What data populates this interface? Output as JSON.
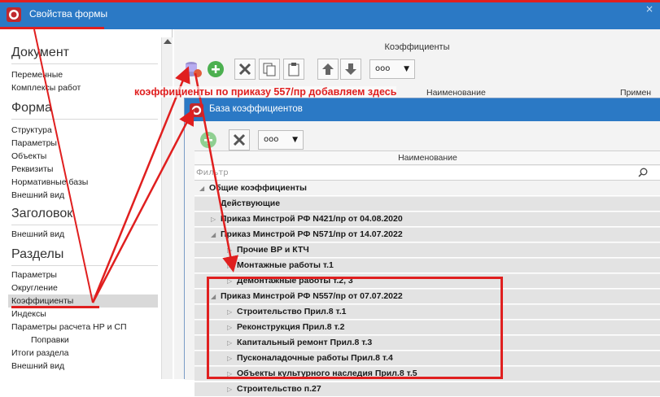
{
  "main_window": {
    "title": "Свойства формы",
    "close": "×"
  },
  "nav": {
    "sections": [
      {
        "title": "Документ",
        "items": [
          "Переменные",
          "Комплексы работ"
        ]
      },
      {
        "title": "Форма",
        "items": [
          "Структура",
          "Параметры",
          "Объекты",
          "Реквизиты",
          "Нормативные базы",
          "Внешний вид"
        ]
      },
      {
        "title": "Заголовок",
        "items": [
          "Внешний вид"
        ]
      },
      {
        "title": "Разделы",
        "items": [
          "Параметры",
          "Округление",
          "Коэффициенты",
          "Индексы",
          "Параметры расчета НР и СП",
          "Поправки",
          "Итоги раздела",
          "Внешний вид"
        ]
      }
    ],
    "selected_item": "Коэффициенты"
  },
  "background_window": {
    "header": "Коэффициенты",
    "dropdown_label": "ooo",
    "columns": [
      "Наименование",
      "Примен"
    ]
  },
  "annotation": {
    "text": "коэффициенты по приказу 557/пр добавляем здесь",
    "color": "#e01f1f"
  },
  "dialog": {
    "title": "База коэффициентов",
    "dropdown_label": "ooo",
    "column_header": "Наименование",
    "filter_placeholder": "Фильтр",
    "tree": [
      {
        "label": "Общие коэффициенты",
        "level": 0,
        "arrow": "◢",
        "grey": false
      },
      {
        "label": "Действующие",
        "level": 1,
        "arrow": "",
        "grey": true
      },
      {
        "label": "Приказ Минстрой РФ N421/пр от 04.08.2020",
        "level": 1,
        "arrow": "▷",
        "grey": true
      },
      {
        "label": "Приказ Минстрой РФ N571/пр от 14.07.2022",
        "level": 1,
        "arrow": "◢",
        "grey": true
      },
      {
        "label": "Прочие ВР и КТЧ",
        "level": 2,
        "arrow": "▷",
        "grey": true
      },
      {
        "label": "Монтажные работы т.1",
        "level": 2,
        "arrow": "▷",
        "grey": true
      },
      {
        "label": "Демонтажные работы т.2, 3",
        "level": 2,
        "arrow": "▷",
        "grey": true
      },
      {
        "label": "Приказ Минстрой РФ N557/пр от 07.07.2022",
        "level": 1,
        "arrow": "◢",
        "grey": true
      },
      {
        "label": "Строительство Прил.8 т.1",
        "level": 2,
        "arrow": "▷",
        "grey": true
      },
      {
        "label": "Реконструкция Прил.8 т.2",
        "level": 2,
        "arrow": "▷",
        "grey": true
      },
      {
        "label": "Капитальный ремонт Прил.8 т.3",
        "level": 2,
        "arrow": "▷",
        "grey": true
      },
      {
        "label": "Пусконаладочные работы Прил.8 т.4",
        "level": 2,
        "arrow": "▷",
        "grey": true
      },
      {
        "label": "Объекты культурного наследия Прил.8 т.5",
        "level": 2,
        "arrow": "▷",
        "grey": true
      },
      {
        "label": "Строительство п.27",
        "level": 2,
        "arrow": "▷",
        "grey": true
      }
    ]
  }
}
